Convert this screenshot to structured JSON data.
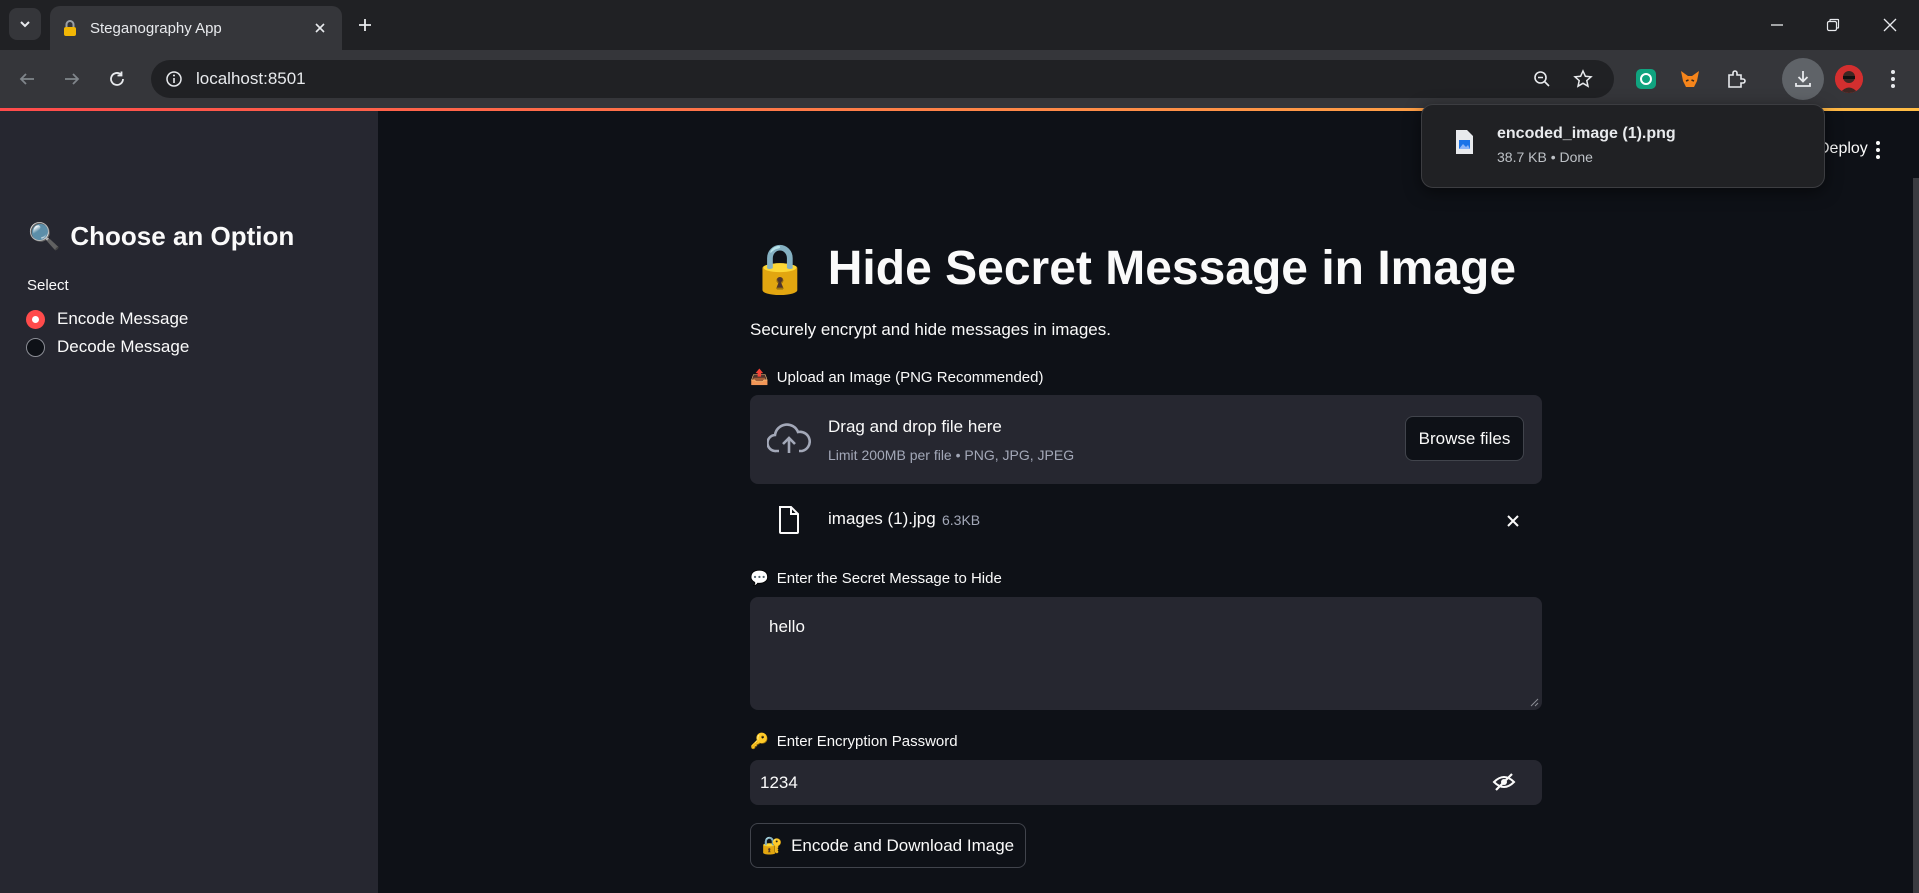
{
  "browser": {
    "tab_title": "Steganography App",
    "url": "localhost:8501"
  },
  "download": {
    "file_name": "encoded_image (1).png",
    "status": "38.7 KB • Done"
  },
  "sidebar": {
    "heading": "Choose an Option",
    "heading_emoji": "🔍",
    "select_label": "Select",
    "options": [
      {
        "label": "Encode Message",
        "selected": true
      },
      {
        "label": "Decode Message",
        "selected": false
      }
    ]
  },
  "header": {
    "deploy_label": "Deploy"
  },
  "main": {
    "title": "Hide Secret Message in Image",
    "title_emoji": "🔒",
    "subtitle": "Securely encrypt and hide messages in images.",
    "upload": {
      "label": "Upload an Image (PNG Recommended)",
      "label_emoji": "📤",
      "drop_title": "Drag and drop file here",
      "limit_text": "Limit 200MB per file • PNG, JPG, JPEG",
      "browse_label": "Browse files",
      "file_name": "images (1).jpg",
      "file_size": "6.3KB"
    },
    "message": {
      "label": "Enter the Secret Message to Hide",
      "label_emoji": "💬",
      "value": "hello"
    },
    "password": {
      "label": "Enter Encryption Password",
      "label_emoji": "🔑",
      "value": "1234"
    },
    "encode_button": {
      "label": "Encode and Download Image",
      "emoji": "🔐"
    }
  },
  "colors": {
    "accent": "#ff4b4b",
    "background": "#0e1117",
    "sidebar": "#262730"
  }
}
